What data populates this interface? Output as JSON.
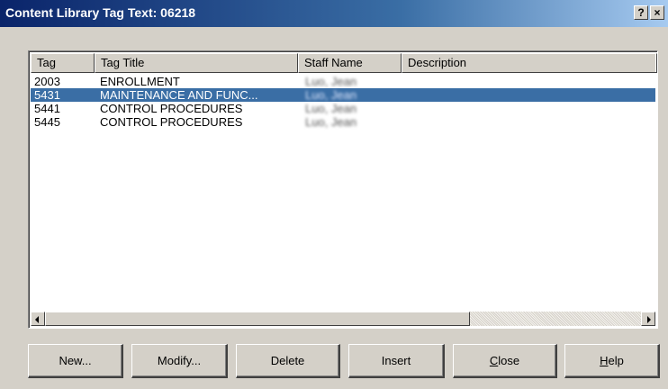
{
  "window": {
    "title": "Content Library Tag Text: 06218",
    "help_label": "?",
    "close_label": "×"
  },
  "table": {
    "columns": [
      {
        "label": "Tag"
      },
      {
        "label": "Tag Title"
      },
      {
        "label": "Staff Name"
      },
      {
        "label": "Description"
      }
    ],
    "rows": [
      {
        "tag": "2003",
        "title": "ENROLLMENT",
        "staff": "Luo, Jean",
        "description": "",
        "selected": false
      },
      {
        "tag": "5431",
        "title": "MAINTENANCE AND FUNC...",
        "staff": "Luo, Jean",
        "description": "",
        "selected": true
      },
      {
        "tag": "5441",
        "title": "CONTROL PROCEDURES",
        "staff": "Luo, Jean",
        "description": "",
        "selected": false
      },
      {
        "tag": "5445",
        "title": "CONTROL PROCEDURES",
        "staff": "Luo, Jean",
        "description": "",
        "selected": false
      }
    ]
  },
  "buttons": {
    "new": "New...",
    "modify": "Modify...",
    "delete": "Delete",
    "insert": "Insert",
    "close_rest": "lose",
    "close_mnemonic": "C",
    "help_rest": "elp",
    "help_mnemonic": "H"
  },
  "colors": {
    "title_gradient_start": "#0a246a",
    "selection": "#3a6ea5",
    "face": "#d4d0c8"
  }
}
